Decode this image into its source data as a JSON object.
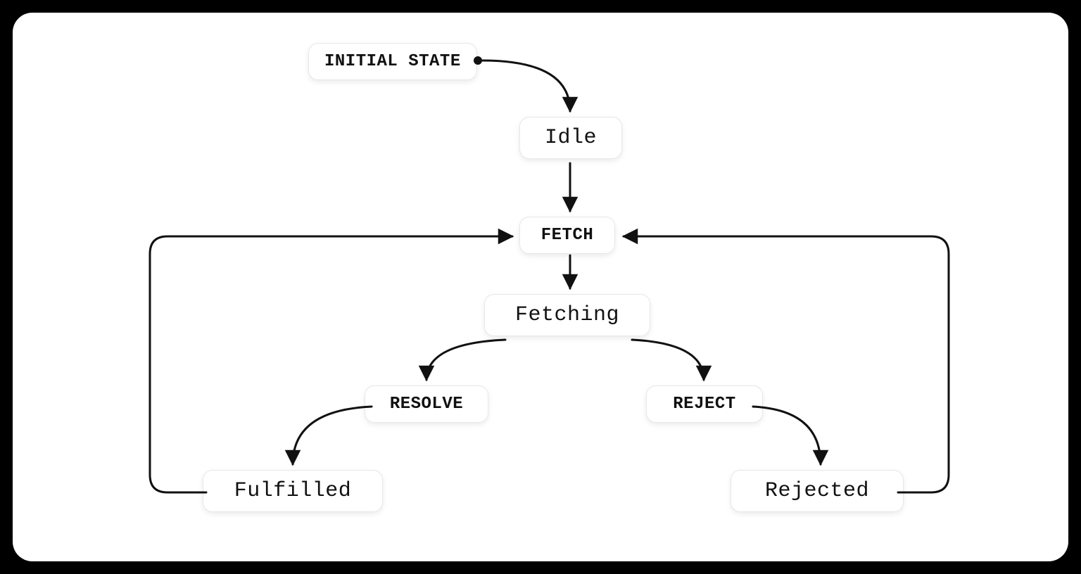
{
  "diagram": {
    "initial_label": "INITIAL STATE",
    "states": {
      "idle": "Idle",
      "fetching": "Fetching",
      "fulfilled": "Fulfilled",
      "rejected": "Rejected"
    },
    "events": {
      "fetch": "FETCH",
      "resolve": "RESOLVE",
      "reject": "REJECT"
    },
    "transitions": [
      {
        "from": "INITIAL STATE",
        "to": "Idle"
      },
      {
        "from": "Idle",
        "event": "FETCH",
        "to": "Fetching"
      },
      {
        "from": "Fetching",
        "event": "RESOLVE",
        "to": "Fulfilled"
      },
      {
        "from": "Fetching",
        "event": "REJECT",
        "to": "Rejected"
      },
      {
        "from": "Fulfilled",
        "event": "FETCH",
        "to": "Fetching"
      },
      {
        "from": "Rejected",
        "event": "FETCH",
        "to": "Fetching"
      }
    ]
  }
}
